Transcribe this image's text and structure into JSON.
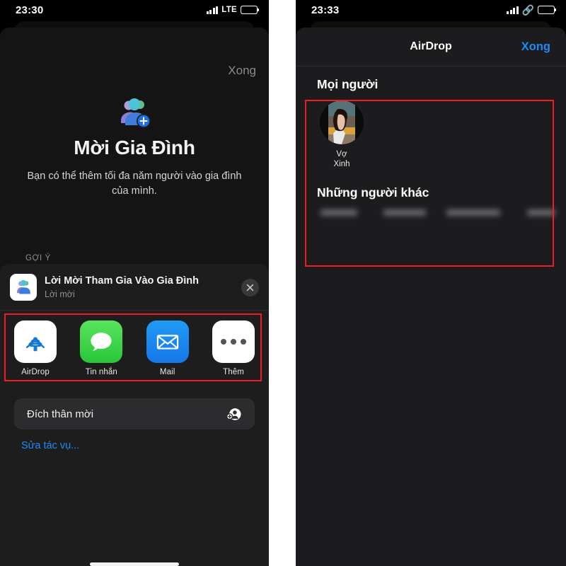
{
  "left_phone": {
    "status_bar": {
      "time": "23:30",
      "network_label": "LTE",
      "signal_icon": "cellular-bars-icon",
      "battery_icon": "battery-low-icon"
    },
    "sheet": {
      "done_label": "Xong",
      "hero_icon": "family-group-add-icon",
      "title": "Mời Gia Đình",
      "subtitle": "Bạn có thể thêm tối đa năm người vào gia đình của mình.",
      "suggestions_header": "GỢI Ý"
    },
    "share_sheet": {
      "app_icon": "family-invitation-app-icon",
      "item_title": "Lời Mời Tham Gia Vào Gia Đình",
      "item_subtitle": "Lời mời",
      "close_icon": "close-x-icon",
      "apps": [
        {
          "label": "AirDrop",
          "icon": "airdrop-icon",
          "tile": "white"
        },
        {
          "label": "Tin nhắn",
          "icon": "messages-icon",
          "tile": "green"
        },
        {
          "label": "Mail",
          "icon": "mail-envelope-icon",
          "tile": "blue"
        },
        {
          "label": "Thêm",
          "icon": "more-dots-icon",
          "tile": "white"
        }
      ],
      "actions": [
        {
          "label": "Đích thân mời",
          "icon": "invite-person-icon"
        }
      ],
      "edit_actions_label": "Sửa tác vụ..."
    },
    "highlight_color": "#ef1b26"
  },
  "right_phone": {
    "status_bar": {
      "time": "23:33",
      "hotspot_icon": "personal-hotspot-link-icon",
      "signal_icon": "cellular-bars-icon",
      "battery_icon": "battery-low-icon"
    },
    "airdrop": {
      "nav_title": "AirDrop",
      "done_label": "Xong",
      "people_section_title": "Mọi người",
      "people": [
        {
          "name_line1": "Vợ",
          "name_line2": "Xinh",
          "avatar": "contact-photo-avatar"
        }
      ],
      "others_section_title": "Những người khác",
      "others": [
        {
          "avatar": "blurred-contact-avatar",
          "name_width": 52
        },
        {
          "avatar": "blurred-contact-avatar",
          "name_width": 60
        },
        {
          "avatar": "blurred-contact-avatar",
          "name_width": 76
        },
        {
          "avatar": "blurred-contact-avatar",
          "name_width": 40
        }
      ]
    },
    "highlight_color": "#ef1b26"
  }
}
